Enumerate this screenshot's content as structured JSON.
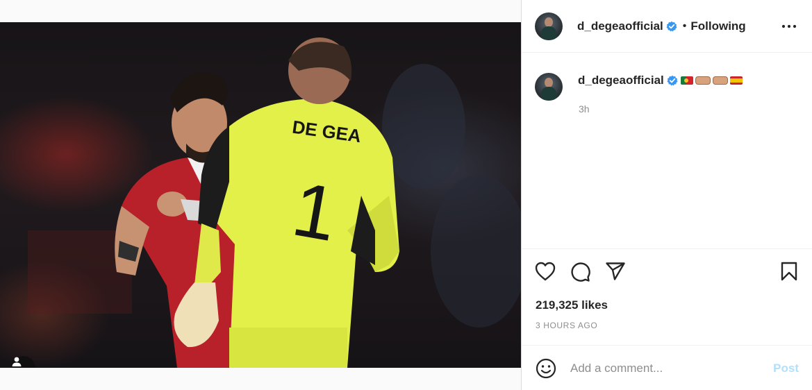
{
  "post": {
    "username": "d_degeaofficial",
    "follow_status": "Following",
    "separator": "•",
    "photo_alt": "DE GEA 1",
    "jersey_name": "DE GEA",
    "jersey_number": "1",
    "caption": {
      "username": "d_degeaofficial",
      "emojis": [
        "portugal-flag",
        "fist-bump",
        "fist-bump",
        "spain-flag"
      ],
      "age": "3h"
    },
    "likes": "219,325 likes",
    "posted_ago": "3 HOURS AGO",
    "comment_placeholder": "Add a comment...",
    "post_label": "Post"
  },
  "colors": {
    "verified": "#3897f0",
    "post_button_disabled": "#b2dffc",
    "keeper_kit": "#e3f04a",
    "opponent_kit": "#c0232b"
  }
}
